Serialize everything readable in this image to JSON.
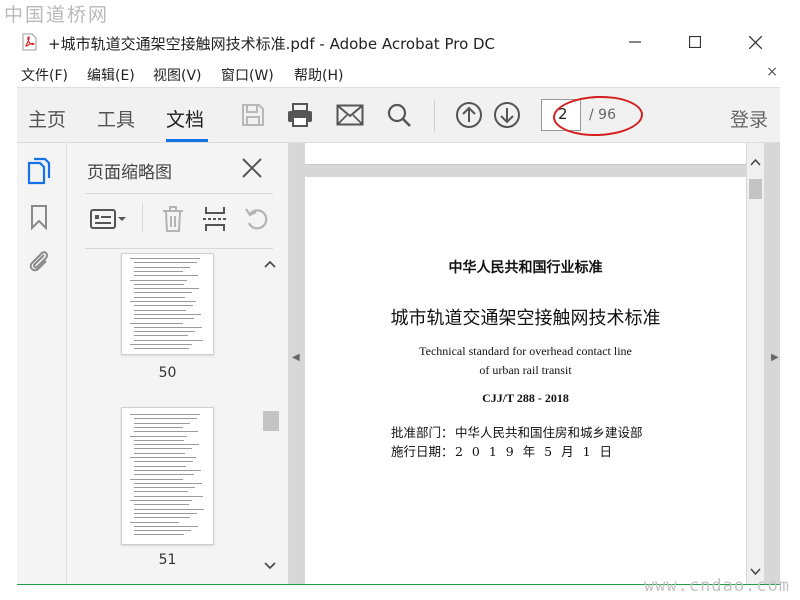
{
  "watermarks": {
    "top": "中国道桥网",
    "bottom": "www.cndao.com"
  },
  "window": {
    "title": "+城市轨道交通架空接触网技术标准.pdf - Adobe Acrobat Pro DC",
    "icon": "pdf-file-icon",
    "controls": [
      "minimize-icon",
      "maximize-icon",
      "close-icon"
    ]
  },
  "menu": {
    "items": [
      "文件(F)",
      "编辑(E)",
      "视图(V)",
      "窗口(W)",
      "帮助(H)"
    ],
    "close_glyph": "×"
  },
  "toolbar": {
    "tabs": [
      "主页",
      "工具",
      "文档"
    ],
    "active_tab": "文档",
    "tools": [
      "save-icon",
      "print-icon",
      "mail-icon",
      "search-icon",
      "page-up-icon",
      "page-down-icon"
    ],
    "current_page": "2",
    "total_pages": "/ 96",
    "login": "登录",
    "highlight_color": "#d42020",
    "accent_color": "#1473e6"
  },
  "left_rail": {
    "icons": [
      "page-thumbnails-icon",
      "bookmark-icon",
      "attachment-icon"
    ],
    "active_icon_color": "#1473e6"
  },
  "thumbnail_panel": {
    "title": "页面缩略图",
    "tools": [
      "thumbnail-options-icon",
      "delete-page-icon",
      "insert-page-icon",
      "rotate-page-icon"
    ],
    "thumbnails": [
      {
        "label": "50"
      },
      {
        "label": "51"
      }
    ]
  },
  "document": {
    "header": "中华人民共和国行业标准",
    "title_cn": "城市轨道交通架空接触网技术标准",
    "title_en_line1": "Technical standard for overhead contact line",
    "title_en_line2": "of urban rail transit",
    "code": "CJJ/T 288 - 2018",
    "approval_label": "批准部门：",
    "approval_value": "中华人民共和国住房和城乡建设部",
    "date_label": "施行日期：",
    "date_value": "2 0 1 9 年 5 月 1 日"
  }
}
